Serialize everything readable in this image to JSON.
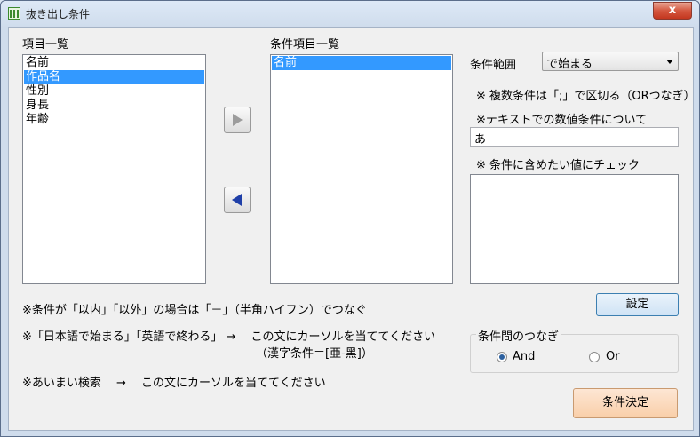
{
  "window": {
    "title": "抜き出し条件",
    "close_label": "x"
  },
  "left_list": {
    "label": "項目一覧",
    "items": [
      "名前",
      "作品名",
      "性別",
      "身長",
      "年齢"
    ],
    "selected_index": 1
  },
  "right_list": {
    "label": "条件項目一覧",
    "items": [
      "名前"
    ],
    "selected_index": 0
  },
  "condition_range": {
    "label": "条件範囲",
    "selected": "で始まる"
  },
  "notes": {
    "multi": "※ 複数条件は「;」で区切る（ORつなぎ）",
    "numeric": "※テキストでの数値条件について",
    "check": "※ 条件に含めたい値にチェック"
  },
  "condition_input": {
    "value": "あ"
  },
  "set_button": "設定",
  "hints": {
    "range": "※条件が「以内」「以外」の場合は「－」（半角ハイフン）でつなぐ",
    "lang_line1": "※「日本語で始まる」「英語で終わる」 →　 この文にカーソルを当ててください",
    "lang_line2": "（漢字条件＝[亜-黑]）",
    "fuzzy": "※あいまい検索　 →　 この文にカーソルを当ててください"
  },
  "join_group": {
    "label": "条件間のつなぎ",
    "and_label": "And",
    "or_label": "Or",
    "selected": "And"
  },
  "decide_button": "条件決定",
  "colors": {
    "selection": "#3399ff",
    "decide_bg": "#fbd9c0",
    "set_bg": "#dcebf7"
  }
}
